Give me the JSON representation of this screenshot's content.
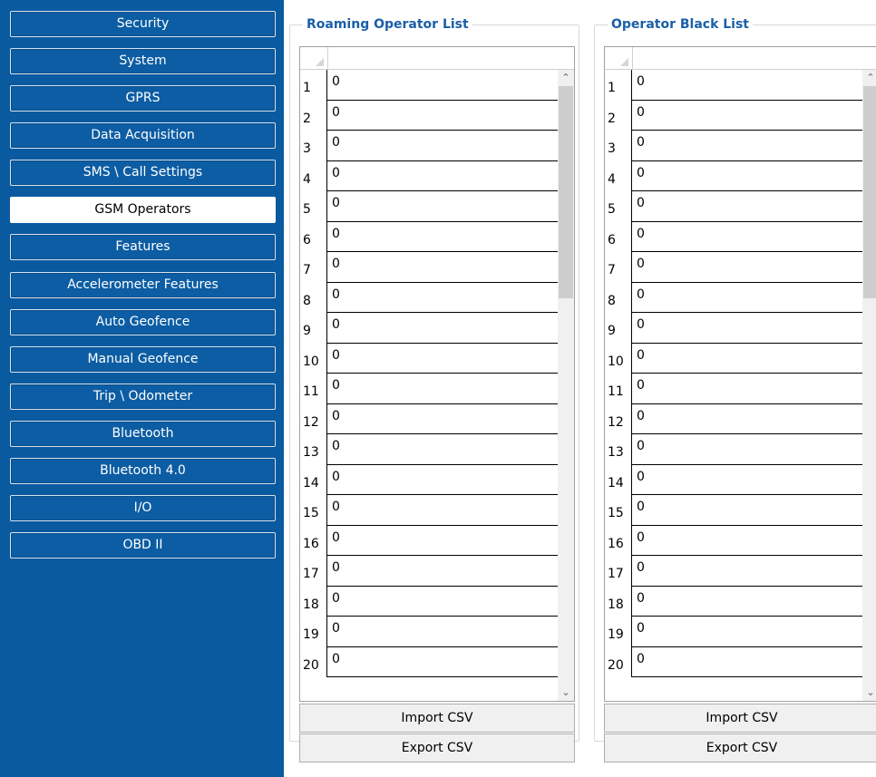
{
  "sidebar": {
    "items": [
      {
        "label": "Security"
      },
      {
        "label": "System"
      },
      {
        "label": "GPRS"
      },
      {
        "label": "Data Acquisition"
      },
      {
        "label": "SMS \\ Call Settings"
      },
      {
        "label": "GSM Operators",
        "active": true
      },
      {
        "label": "Features"
      },
      {
        "label": "Accelerometer Features"
      },
      {
        "label": "Auto Geofence"
      },
      {
        "label": "Manual Geofence"
      },
      {
        "label": "Trip \\ Odometer"
      },
      {
        "label": "Bluetooth"
      },
      {
        "label": "Bluetooth 4.0"
      },
      {
        "label": "I/O"
      },
      {
        "label": "OBD II"
      }
    ]
  },
  "roaming": {
    "title": "Roaming Operator List",
    "rows": [
      {
        "num": "1",
        "value": "0"
      },
      {
        "num": "2",
        "value": "0"
      },
      {
        "num": "3",
        "value": "0"
      },
      {
        "num": "4",
        "value": "0"
      },
      {
        "num": "5",
        "value": "0"
      },
      {
        "num": "6",
        "value": "0"
      },
      {
        "num": "7",
        "value": "0"
      },
      {
        "num": "8",
        "value": "0"
      },
      {
        "num": "9",
        "value": "0"
      },
      {
        "num": "10",
        "value": "0"
      },
      {
        "num": "11",
        "value": "0"
      },
      {
        "num": "12",
        "value": "0"
      },
      {
        "num": "13",
        "value": "0"
      },
      {
        "num": "14",
        "value": "0"
      },
      {
        "num": "15",
        "value": "0"
      },
      {
        "num": "16",
        "value": "0"
      },
      {
        "num": "17",
        "value": "0"
      },
      {
        "num": "18",
        "value": "0"
      },
      {
        "num": "19",
        "value": "0"
      },
      {
        "num": "20",
        "value": "0"
      }
    ],
    "import_label": "Import CSV",
    "export_label": "Export CSV"
  },
  "blacklist": {
    "title": "Operator Black List",
    "rows": [
      {
        "num": "1",
        "value": "0"
      },
      {
        "num": "2",
        "value": "0"
      },
      {
        "num": "3",
        "value": "0"
      },
      {
        "num": "4",
        "value": "0"
      },
      {
        "num": "5",
        "value": "0"
      },
      {
        "num": "6",
        "value": "0"
      },
      {
        "num": "7",
        "value": "0"
      },
      {
        "num": "8",
        "value": "0"
      },
      {
        "num": "9",
        "value": "0"
      },
      {
        "num": "10",
        "value": "0"
      },
      {
        "num": "11",
        "value": "0"
      },
      {
        "num": "12",
        "value": "0"
      },
      {
        "num": "13",
        "value": "0"
      },
      {
        "num": "14",
        "value": "0"
      },
      {
        "num": "15",
        "value": "0"
      },
      {
        "num": "16",
        "value": "0"
      },
      {
        "num": "17",
        "value": "0"
      },
      {
        "num": "18",
        "value": "0"
      },
      {
        "num": "19",
        "value": "0"
      },
      {
        "num": "20",
        "value": "0"
      }
    ],
    "import_label": "Import CSV",
    "export_label": "Export CSV"
  },
  "icons": {
    "scroll_up": "chevron-up-icon",
    "scroll_down": "chevron-down-icon"
  },
  "colors": {
    "sidebar_bg": "#0a5aa0",
    "title_blue": "#1a5fa8",
    "active_bg": "#ffffff"
  }
}
